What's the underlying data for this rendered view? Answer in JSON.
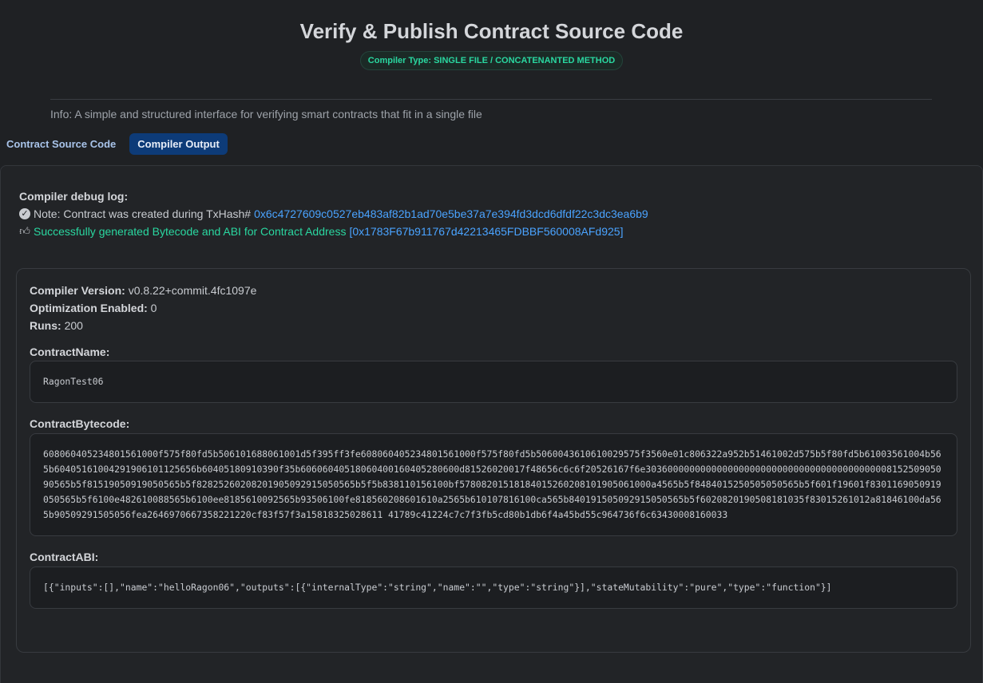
{
  "header": {
    "title": "Verify & Publish Contract Source Code",
    "badge": "Compiler Type: SINGLE FILE / CONCATENANTED METHOD"
  },
  "info": "Info: A simple and structured interface for verifying smart contracts that fit in a single file",
  "tabs": [
    {
      "label": "Contract Source Code",
      "active": false
    },
    {
      "label": "Compiler Output",
      "active": true
    }
  ],
  "debug": {
    "label": "Compiler debug log:",
    "note_prefix": "Note: Contract was created during TxHash#",
    "tx_hash": "0x6c4727609c0527eb483af82b1ad70e5be37a7e394fd3dcd6dfdf22c3dc3ea6b9",
    "success_prefix": "Successfully generated Bytecode and ABI for Contract Address",
    "contract_address": "[0x1783F67b911767d42213465FDBBF560008AFd925]"
  },
  "compiler": {
    "version_label": "Compiler Version:",
    "version": "v0.8.22+commit.4fc1097e",
    "optimization_label": "Optimization Enabled:",
    "optimization": "0",
    "runs_label": "Runs:",
    "runs": "200"
  },
  "contract": {
    "name_label": "ContractName:",
    "name": "RagonTest06",
    "bytecode_label": "ContractBytecode:",
    "bytecode": "608060405234801561000f575f80fd5b506101688061001d5f395ff3fe608060405234801561000f575f80fd5b5060043610610029575f3560e01c806322a952b51461002d575b5f80fd5b61003561004b565b60405161004291906101125656b60405180910390f35b60606040518060400160405280600d81526020017f48656c6c6f20526167f6e30360000000000000000000000000000000000000000815250905090565b5f81519050919050565b5f82825260208201905092915050565b5f5b838110156100bf57808201518184015260208101905061000a4565b5f8484015250505050565b5f601f19601f8301169050919050565b5f6100e482610088565b6100ee8185610092565b93506100fe818560208601610a2565b610107816100ca565b840191505092915050565b5f6020820190508181035f83015261012a81846100da565b90509291505056fea2646970667358221220cf83f57f3a15818325028611 41789c41224c7c7f3fb5cd80b1db6f4a45bd55c964736f6c63430008160033",
    "abi_label": "ContractABI:",
    "abi": "[{\"inputs\":[],\"name\":\"helloRagon06\",\"outputs\":[{\"internalType\":\"string\",\"name\":\"\",\"type\":\"string\"}],\"stateMutability\":\"pure\",\"type\":\"function\"}]"
  }
}
